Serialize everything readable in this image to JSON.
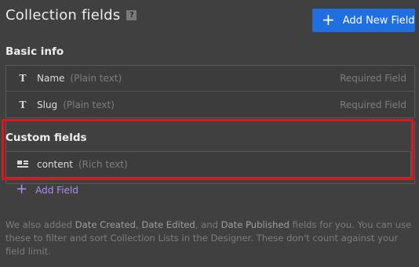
{
  "header": {
    "title": "Collection fields",
    "help_label": "?"
  },
  "toolbar": {
    "add_new_field_label": "Add New Field",
    "add_new_icon": "plus-icon"
  },
  "basic_info": {
    "section_title": "Basic info",
    "fields": [
      {
        "name": "Name",
        "type": "(Plain text)",
        "required": "Required Field",
        "icon": "text-type-icon"
      },
      {
        "name": "Slug",
        "type": "(Plain text)",
        "required": "Required Field",
        "icon": "text-type-icon"
      }
    ]
  },
  "custom_fields": {
    "section_title": "Custom fields",
    "fields": [
      {
        "name": "content",
        "type": "(Rich text)",
        "icon": "rich-text-icon"
      }
    ],
    "add_field_label": "Add Field"
  },
  "footnote": {
    "part1": "We also added ",
    "date_created": "Date Created",
    "part2": ", ",
    "date_edited": "Date Edited",
    "part3": ", and ",
    "date_published": "Date Published",
    "part4": " fields for you. You can use these to filter and sort Collection Lists in the Designer. These don't count against your field limit."
  },
  "colors": {
    "accent": "#1f6fe0",
    "add_field": "#a98ef0",
    "highlight": "#e0141b",
    "background": "#404040"
  }
}
